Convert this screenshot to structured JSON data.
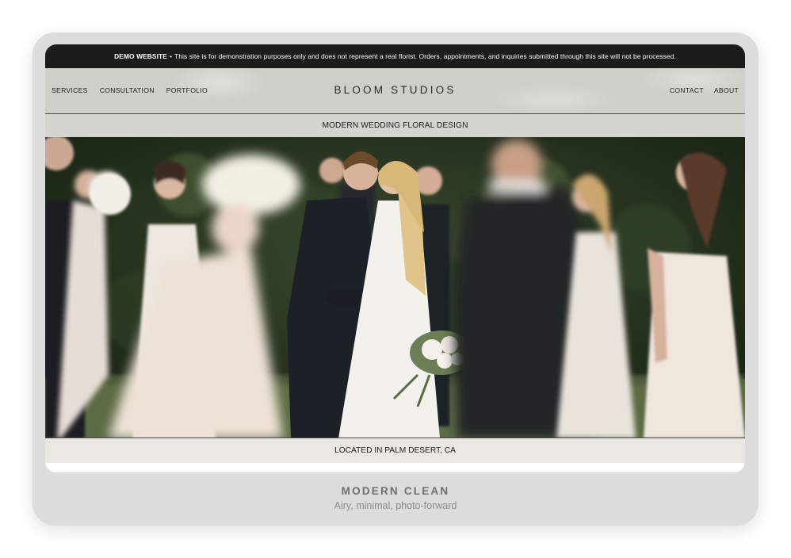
{
  "demo_banner": {
    "label": "DEMO WEBSITE",
    "separator": "•",
    "text": "This site is for demonstration purposes only and does not represent a real florist. Orders, appointments, and inquiries submitted through this site will not be processed."
  },
  "header": {
    "brand": "BLOOM STUDIOS",
    "nav_left": [
      {
        "label": "SERVICES"
      },
      {
        "label": "CONSULTATION"
      },
      {
        "label": "PORTFOLIO"
      }
    ],
    "nav_right": [
      {
        "label": "CONTACT"
      },
      {
        "label": "ABOUT"
      }
    ]
  },
  "hero": {
    "tagline": "MODERN WEDDING FLORAL DESIGN",
    "image": "wedding-party-photo",
    "location": "LOCATED IN PALM DESERT, CA"
  },
  "caption": {
    "title": "MODERN CLEAN",
    "subtitle": "Airy, minimal, photo-forward"
  },
  "colors": {
    "banner_bg": "#1c1c1c",
    "header_bg": "#cdd0c8",
    "card_bg": "#dcdcdc",
    "foliage": "#27331f"
  }
}
